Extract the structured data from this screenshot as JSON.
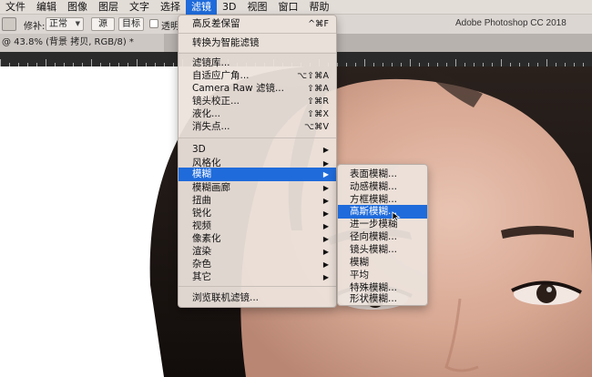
{
  "menubar": {
    "items": [
      "文件",
      "编辑",
      "图像",
      "图层",
      "文字",
      "选择",
      "滤镜",
      "3D",
      "视图",
      "窗口",
      "帮助"
    ],
    "active_index": 6
  },
  "options": {
    "repair_label": "修补:",
    "mode_value": "正常",
    "source_button": "源",
    "dest_button": "目标",
    "transparent_label": "透明"
  },
  "app_title": "Adobe Photoshop CC 2018",
  "doc_tab": "@ 43.8% (背景 拷贝, RGB/8) *",
  "filter_menu": {
    "items": [
      {
        "label": "高反差保留",
        "shortcut": "^⌘F"
      },
      {
        "label": "转换为智能滤镜",
        "shortcut": ""
      },
      {
        "label": "滤镜库...",
        "shortcut": ""
      },
      {
        "label": "自适应广角...",
        "shortcut": "⌥⇧⌘A"
      },
      {
        "label": "Camera Raw 滤镜...",
        "shortcut": "⇧⌘A"
      },
      {
        "label": "镜头校正...",
        "shortcut": "⇧⌘R"
      },
      {
        "label": "液化...",
        "shortcut": "⇧⌘X"
      },
      {
        "label": "消失点...",
        "shortcut": "⌥⌘V"
      },
      {
        "label": "3D",
        "submenu": true
      },
      {
        "label": "风格化",
        "submenu": true
      },
      {
        "label": "模糊",
        "submenu": true,
        "highlighted": true
      },
      {
        "label": "模糊画廊",
        "submenu": true
      },
      {
        "label": "扭曲",
        "submenu": true
      },
      {
        "label": "锐化",
        "submenu": true
      },
      {
        "label": "视频",
        "submenu": true
      },
      {
        "label": "像素化",
        "submenu": true
      },
      {
        "label": "渲染",
        "submenu": true
      },
      {
        "label": "杂色",
        "submenu": true
      },
      {
        "label": "其它",
        "submenu": true
      },
      {
        "label": "浏览联机滤镜...",
        "shortcut": ""
      }
    ]
  },
  "blur_submenu": {
    "items": [
      {
        "label": "表面模糊..."
      },
      {
        "label": "动感模糊..."
      },
      {
        "label": "方框模糊..."
      },
      {
        "label": "高斯模糊...",
        "highlighted": true
      },
      {
        "label": "进一步模糊"
      },
      {
        "label": "径向模糊..."
      },
      {
        "label": "镜头模糊..."
      },
      {
        "label": "模糊"
      },
      {
        "label": "平均"
      },
      {
        "label": "特殊模糊..."
      },
      {
        "label": "形状模糊..."
      }
    ]
  },
  "colors": {
    "highlight": "#1f6bdb",
    "menubar_bg": "#e3ddd8"
  },
  "icons": [
    "repair-tool-icon",
    "submenu-arrow-icon",
    "pointer-cursor-icon"
  ]
}
